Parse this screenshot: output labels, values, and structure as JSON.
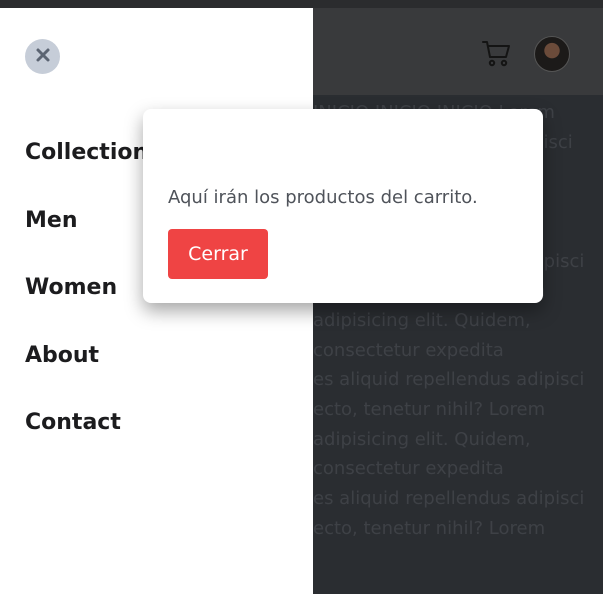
{
  "drawer": {
    "nav": [
      "Collection",
      "Men",
      "Women",
      "About",
      "Contact"
    ]
  },
  "header": {
    "icons": [
      "close-icon",
      "cart-icon",
      "avatar"
    ]
  },
  "background_text": [
    "INICIO INICIO INICIO Lorem",
    "ipsum dolor sit amet adipisci",
    "",
    "",
    "",
    "es aliquid repellendus adipisci",
    "ecto, tenetur nihil? Lorem",
    "adipisicing elit. Quidem,",
    "consectetur expedita",
    "es aliquid repellendus adipisci",
    "ecto, tenetur nihil? Lorem",
    "adipisicing elit. Quidem,",
    "consectetur expedita",
    "es aliquid repellendus adipisci",
    "ecto, tenetur nihil? Lorem"
  ],
  "modal": {
    "message": "Aquí irán los productos del carrito.",
    "button_label": "Cerrar",
    "button_color": "#ef4444"
  }
}
